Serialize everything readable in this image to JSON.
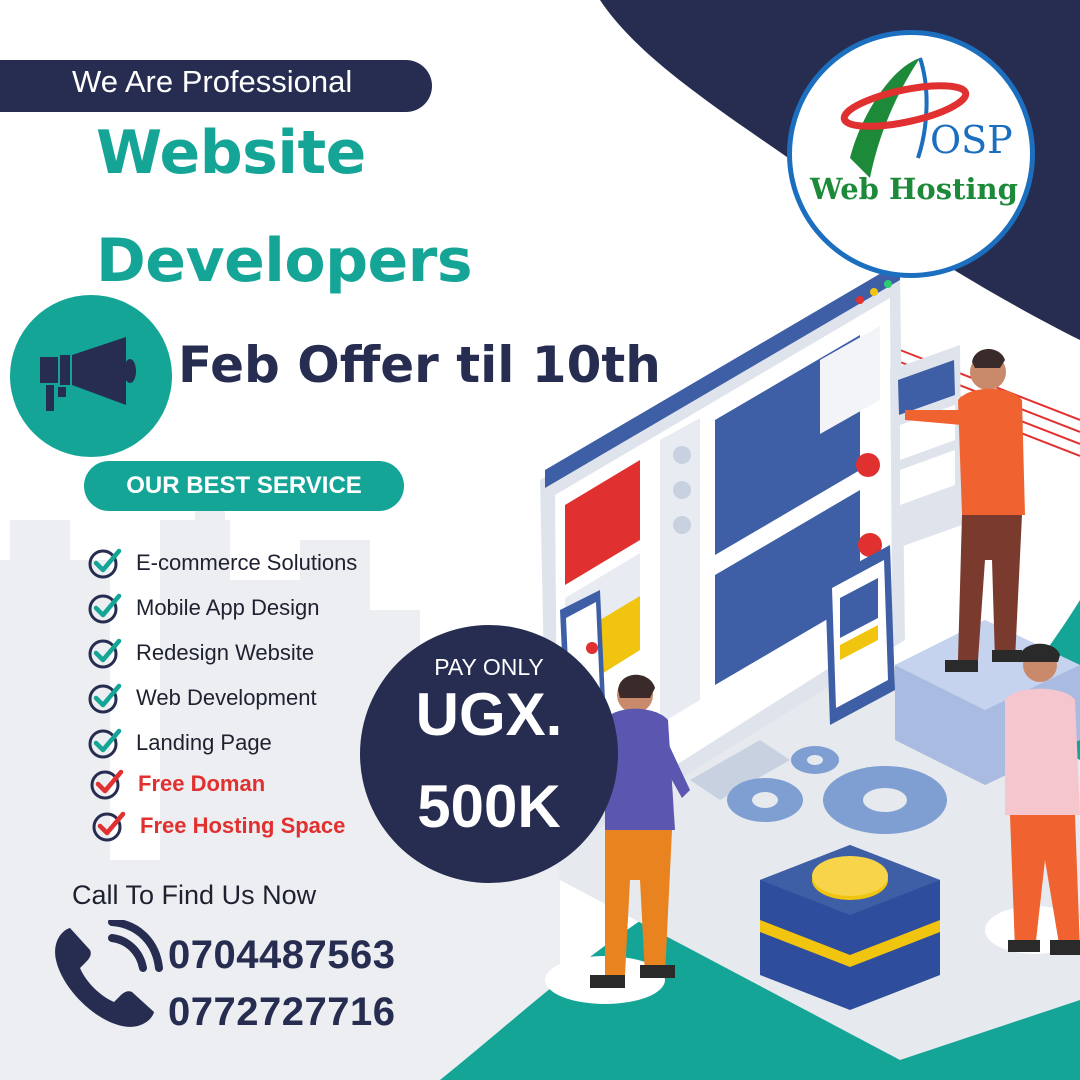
{
  "tagline": "We Are Professional",
  "headline": {
    "line1": "Website",
    "line2": "Developers"
  },
  "offer": "Feb Offer til 10th",
  "services_title": "OUR BEST SERVICE",
  "services": [
    {
      "label": "E-commerce Solutions",
      "style": "normal"
    },
    {
      "label": "Mobile App Design",
      "style": "normal"
    },
    {
      "label": "Redesign Website",
      "style": "normal"
    },
    {
      "label": "Web Development",
      "style": "normal"
    },
    {
      "label": "Landing Page",
      "style": "normal"
    },
    {
      "label": "Free Doman",
      "style": "highlight"
    },
    {
      "label": "Free Hosting Space",
      "style": "highlight"
    }
  ],
  "price": {
    "prefix": "PAY ONLY",
    "currency": "UGX.",
    "amount": "500K"
  },
  "contact": {
    "heading": "Call To Find Us Now",
    "phones": [
      "0704487563",
      "0772727716"
    ]
  },
  "logo": {
    "brand": "OSP",
    "subtitle": "Web Hosting"
  },
  "icons": [
    "megaphone-icon",
    "checkmark-icon",
    "phone-icon"
  ],
  "colors": {
    "navy": "#262d50",
    "teal": "#15a597",
    "red": "#e0302f",
    "logo_blue": "#1c6fbf",
    "logo_green": "#1d8a3a"
  }
}
